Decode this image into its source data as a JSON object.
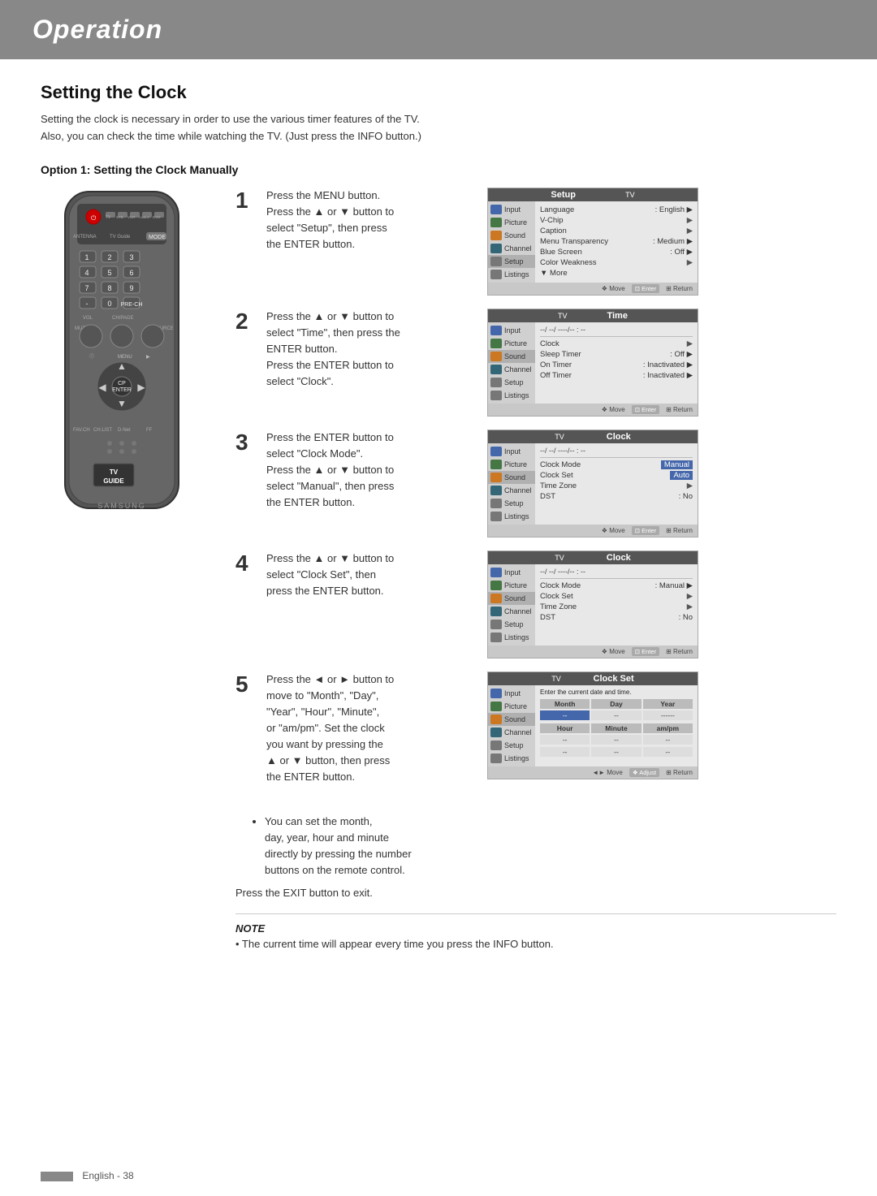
{
  "header": {
    "title": "Operation",
    "background": "#888888"
  },
  "page": {
    "section_title": "Setting the Clock",
    "intro_line1": "Setting the clock is necessary in order to use the various timer features of the TV.",
    "intro_line2": "Also, you can check the time while watching the TV. (Just press the INFO button.)",
    "option_title": "Option 1: Setting the Clock Manually"
  },
  "steps": [
    {
      "number": "1",
      "text": "Press the MENU button.\nPress the ▲ or ▼ button to select \"Setup\", then press the ENTER button."
    },
    {
      "number": "2",
      "text": "Press the ▲ or ▼ button to select \"Time\", then press the ENTER button.\nPress the ENTER button to select \"Clock\"."
    },
    {
      "number": "3",
      "text": "Press the ENTER button to select \"Clock Mode\".\nPress the ▲ or ▼ button to select \"Manual\", then press the ENTER button."
    },
    {
      "number": "4",
      "text": "Press the ▲ or ▼ button to select \"Clock Set\", then press the ENTER button."
    },
    {
      "number": "5",
      "text": "Press the ◄ or ► button to move to \"Month\", \"Day\", \"Year\", \"Hour\", \"Minute\", or \"am/pm\". Set the clock you want by pressing the ▲ or ▼ button, then press the ENTER button."
    }
  ],
  "bullets": [
    "You can set the month, day, year, hour and minute directly by pressing the number buttons on the remote control."
  ],
  "exit_text": "Press the EXIT button to exit.",
  "note_title": "NOTE",
  "note_text": "• The current time will appear every time you press the INFO button.",
  "footer": {
    "language": "English",
    "page": "38"
  },
  "panels": {
    "setup": {
      "title": "Setup",
      "sidebar": [
        "Input",
        "Picture",
        "Sound",
        "Channel",
        "Setup",
        "Listings"
      ],
      "time_display": "",
      "rows": [
        {
          "label": "Language",
          "value": ": English",
          "has_arrow": true
        },
        {
          "label": "V-Chip",
          "value": "",
          "has_arrow": true
        },
        {
          "label": "Caption",
          "value": "",
          "has_arrow": true
        },
        {
          "label": "Menu Transparency",
          "value": ": Medium",
          "has_arrow": true
        },
        {
          "label": "Blue Screen",
          "value": ": Off",
          "has_arrow": true
        },
        {
          "label": "Color Weakness",
          "value": "",
          "has_arrow": true
        },
        {
          "label": "▼ More",
          "value": "",
          "has_arrow": false
        }
      ],
      "footer": [
        "Move",
        "Enter",
        "Return"
      ]
    },
    "time": {
      "title": "Time",
      "sidebar": [
        "Input",
        "Picture",
        "Sound",
        "Channel",
        "Setup",
        "Listings"
      ],
      "time_display": "--/ --/ ----/-- : --",
      "rows": [
        {
          "label": "Clock",
          "value": "",
          "has_arrow": true
        },
        {
          "label": "Sleep Timer",
          "value": ": Off",
          "has_arrow": true
        },
        {
          "label": "On Timer",
          "value": ": Inactivated",
          "has_arrow": true
        },
        {
          "label": "Off Timer",
          "value": ": Inactivated",
          "has_arrow": true
        }
      ],
      "footer": [
        "Move",
        "Enter",
        "Return"
      ]
    },
    "clock1": {
      "title": "Clock",
      "sidebar": [
        "Input",
        "Picture",
        "Sound",
        "Channel",
        "Setup",
        "Listings"
      ],
      "time_display": "--/ --/ ----/-- : --",
      "rows": [
        {
          "label": "Clock Mode",
          "value": "Manual",
          "highlight": true,
          "has_arrow": false
        },
        {
          "label": "Clock Set",
          "value": "Auto",
          "highlight": true,
          "has_arrow": false
        },
        {
          "label": "Time Zone",
          "value": "",
          "has_arrow": true
        },
        {
          "label": "DST",
          "value": ": No",
          "has_arrow": false
        }
      ],
      "footer": [
        "Move",
        "Enter",
        "Return"
      ]
    },
    "clock2": {
      "title": "Clock",
      "sidebar": [
        "Input",
        "Picture",
        "Sound",
        "Channel",
        "Setup",
        "Listings"
      ],
      "time_display": "--/ --/ ----/-- : --",
      "rows": [
        {
          "label": "Clock Mode",
          "value": ": Manual",
          "has_arrow": true
        },
        {
          "label": "Clock Set",
          "value": "",
          "has_arrow": true
        },
        {
          "label": "Time Zone",
          "value": "",
          "has_arrow": true
        },
        {
          "label": "DST",
          "value": ": No",
          "has_arrow": false
        }
      ],
      "footer": [
        "Move",
        "Enter",
        "Return"
      ]
    },
    "clockset": {
      "title": "Clock Set",
      "sidebar": [
        "Input",
        "Picture",
        "Sound",
        "Channel",
        "Setup",
        "Listings"
      ],
      "subtitle": "Enter the current date and time.",
      "headers": [
        "Month",
        "Day",
        "Year"
      ],
      "row1_values": [
        "--",
        "--",
        "------"
      ],
      "headers2": [
        "Hour",
        "Minute",
        "am/pm"
      ],
      "row2_values": [
        "--",
        "--",
        "--"
      ],
      "row3_values": [
        "--",
        "--",
        "--"
      ],
      "footer": [
        "Move",
        "Adjust",
        "Return"
      ]
    }
  }
}
